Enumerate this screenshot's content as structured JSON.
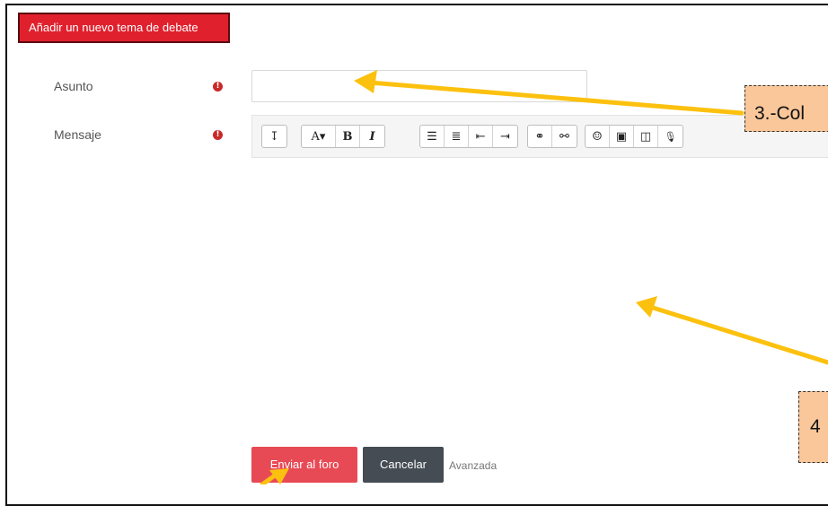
{
  "form": {
    "add_topic_label": "Añadir un nuevo tema de debate",
    "subject_label": "Asunto",
    "message_label": "Mensaje",
    "required_glyph": "!",
    "subject_value": "",
    "subject_placeholder": ""
  },
  "toolbar": {
    "groups": [
      [
        "collapse-icon"
      ],
      [
        "font-size-icon",
        "bold-icon",
        "italic-icon"
      ],
      [
        "unordered-list-icon",
        "ordered-list-icon",
        "outdent-icon",
        "indent-icon"
      ],
      [
        "link-icon",
        "unlink-icon"
      ],
      [
        "emoji-icon",
        "image-icon",
        "media-icon",
        "record-audio-icon"
      ]
    ],
    "glyphs": {
      "collapse": "↧",
      "font_size": "A▾",
      "bold": "B",
      "italic": "I",
      "unordered_list": "☰",
      "ordered_list": "≣",
      "outdent": "⇤",
      "indent": "⇥",
      "link": "⚭",
      "unlink": "⚯",
      "emoji": "☺",
      "image": "▣",
      "media": "◫",
      "record_audio": "🎙"
    }
  },
  "actions": {
    "send_label": "Enviar al foro",
    "cancel_label": "Cancelar",
    "advanced_label": "Avanzada"
  },
  "annotations": {
    "callout_3": "3.-Col",
    "callout_4": "4",
    "arrow_color": "#fcc10f"
  },
  "colors": {
    "add_topic_bg": "#e0202d",
    "send_bg": "#e84a55",
    "cancel_bg": "#454c53",
    "required_icon": "#c9292a",
    "callout_bg": "#fac79a"
  }
}
